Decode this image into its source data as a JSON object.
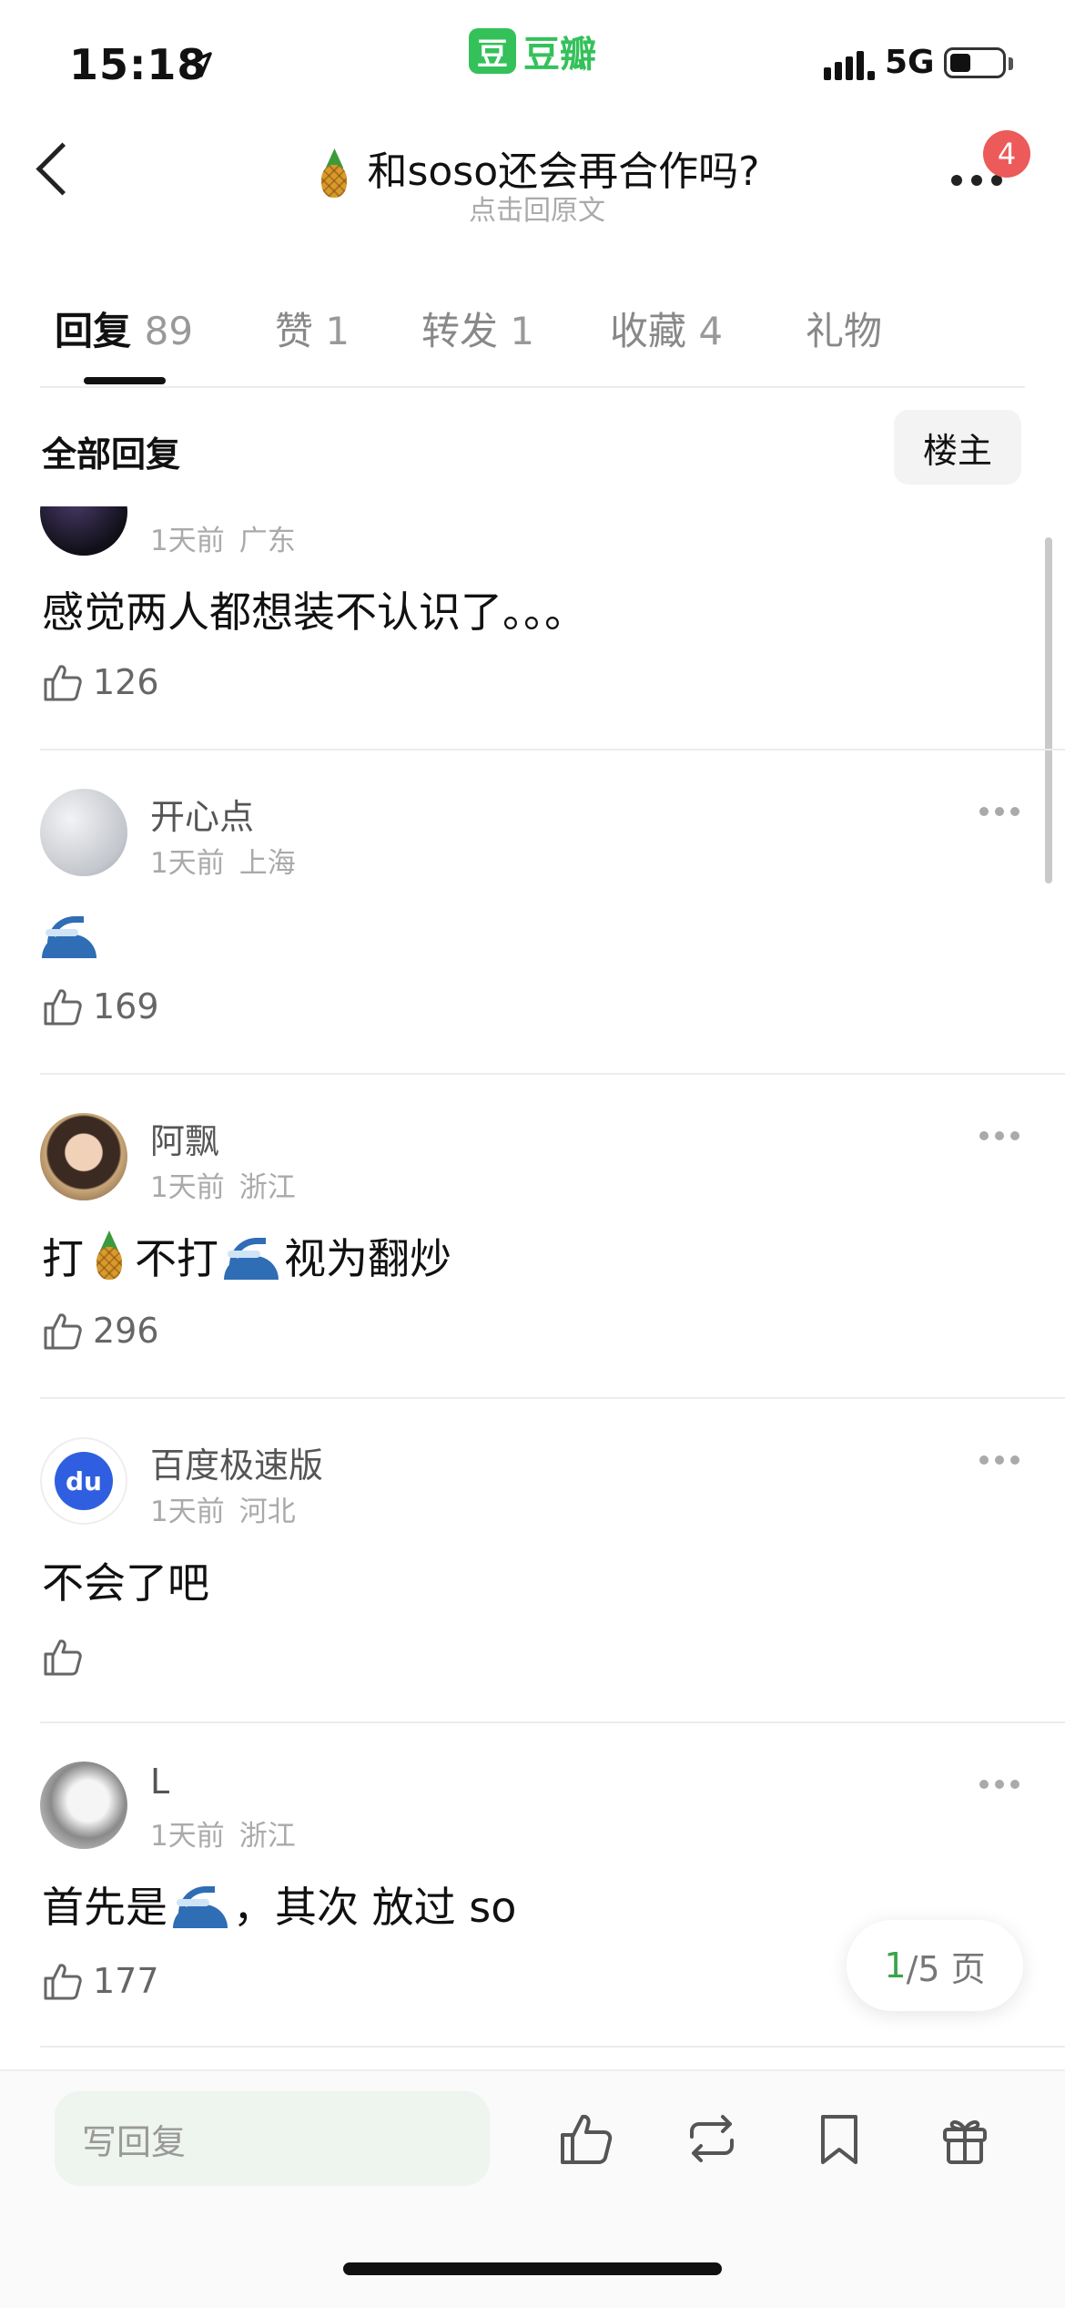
{
  "status_bar": {
    "time": "15:18",
    "network": "5G"
  },
  "brand": {
    "badge": "豆",
    "name": "豆瓣"
  },
  "nav": {
    "title": "和soso还会再合作吗?",
    "subtitle": "点击回原文",
    "notification_count": "4"
  },
  "tabs": [
    {
      "label": "回复",
      "count": "89"
    },
    {
      "label": "赞",
      "count": "1"
    },
    {
      "label": "转发",
      "count": "1"
    },
    {
      "label": "收藏",
      "count": "4"
    },
    {
      "label": "礼物",
      "count": ""
    }
  ],
  "filter": {
    "all_label": "全部回复",
    "op_button": "楼主"
  },
  "comments": [
    {
      "username": "",
      "time": "1天前",
      "location": "广东",
      "text": "感觉两人都想装不认识了。。。",
      "likes": "126"
    },
    {
      "username": "开心点",
      "time": "1天前",
      "location": "上海",
      "text": "",
      "likes": "169"
    },
    {
      "username": "阿飘",
      "time": "1天前",
      "location": "浙江",
      "text_parts": [
        "打",
        "不打",
        "视为翻炒"
      ],
      "likes": "296"
    },
    {
      "username": "百度极速版",
      "time": "1天前",
      "location": "河北",
      "text": "不会了吧",
      "likes": "",
      "avatar_text": "du"
    },
    {
      "username": "L",
      "time": "1天前",
      "location": "浙江",
      "text_parts": [
        "首先是",
        "，其次 放过 so"
      ],
      "likes": "177"
    }
  ],
  "pager": {
    "current": "1",
    "rest": "/5 页"
  },
  "bottom_bar": {
    "reply_placeholder": "写回复"
  },
  "colors": {
    "brand_green": "#34c15a",
    "badge_red": "#ec5a5a",
    "pager_green": "#3aa44a"
  }
}
